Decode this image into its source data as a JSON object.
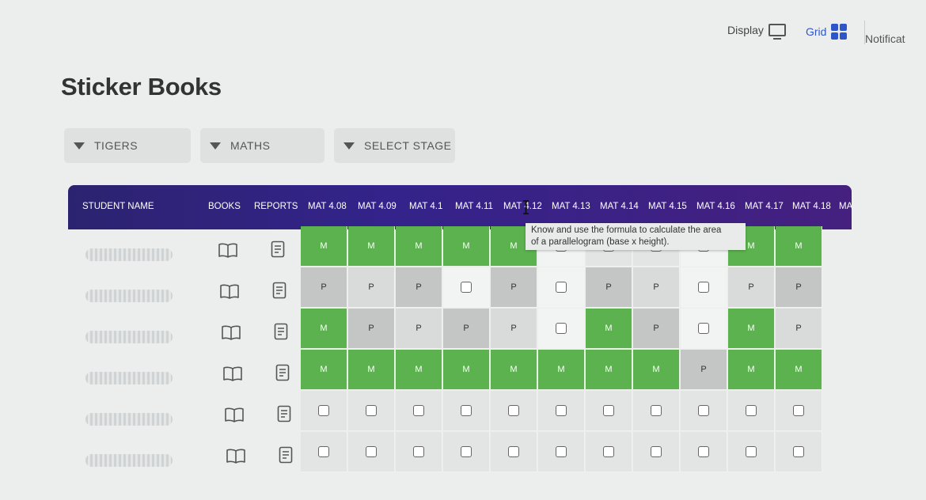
{
  "topbar": {
    "display_label": "Display",
    "grid_label": "Grid",
    "notifications_label": "Notificat"
  },
  "page": {
    "title": "Sticker Books"
  },
  "filters": [
    {
      "label": "TIGERS"
    },
    {
      "label": "MATHS"
    },
    {
      "label": "SELECT STAGE"
    }
  ],
  "table": {
    "headers": {
      "student_name": "STUDENT NAME",
      "books": "BOOKS",
      "reports": "REPORTS",
      "objectives": [
        "MAT 4.08",
        "MAT 4.09",
        "MAT 4.1",
        "MAT 4.11",
        "MAT 4.12",
        "MAT 4.13",
        "MAT 4.14",
        "MAT 4.15",
        "MAT 4.16",
        "MAT 4.17",
        "MAT 4.18",
        "MA"
      ]
    },
    "rows": [
      [
        "M",
        "M",
        "M",
        "M",
        "M",
        "",
        "",
        "",
        "",
        "M",
        "M"
      ],
      [
        "P",
        "P",
        "P",
        "",
        "P",
        "",
        "P",
        "P",
        "",
        "P",
        "P"
      ],
      [
        "M",
        "P",
        "P",
        "P",
        "P",
        "",
        "M",
        "P",
        "",
        "M",
        "P"
      ],
      [
        "M",
        "M",
        "M",
        "M",
        "M",
        "M",
        "M",
        "M",
        "P",
        "M",
        "M"
      ],
      [
        "",
        "",
        "",
        "",
        "",
        "",
        "",
        "",
        "",
        "",
        ""
      ],
      [
        "",
        "",
        "",
        "",
        "",
        "",
        "",
        "",
        "",
        "",
        ""
      ]
    ]
  },
  "tooltip": {
    "text_line1": "Know and use the formula to calculate the area",
    "text_line2": "of a parallelogram (base x height)."
  },
  "colors": {
    "header_start": "#2c2370",
    "header_end": "#45207f",
    "mastered": "#5cb24f",
    "progress": "#c4c6c6",
    "accent": "#2f56c9"
  }
}
